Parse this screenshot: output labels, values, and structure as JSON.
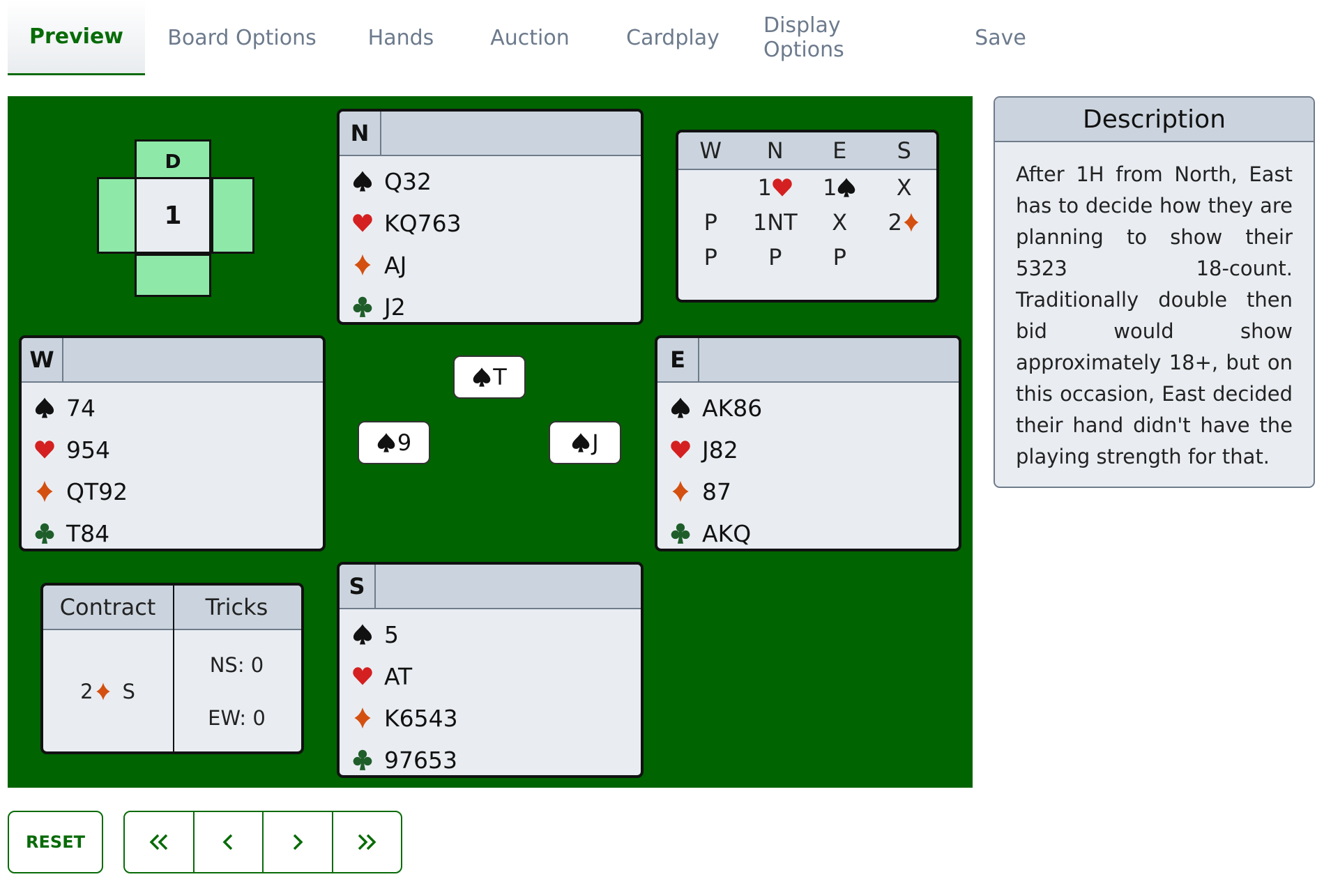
{
  "tabs": [
    {
      "label": "Preview",
      "active": true
    },
    {
      "label": "Board Options"
    },
    {
      "label": "Hands"
    },
    {
      "label": "Auction"
    },
    {
      "label": "Cardplay"
    },
    {
      "label": "Display Options"
    },
    {
      "label": "Save"
    }
  ],
  "colors": {
    "table_green": "#006400",
    "accent_green": "#086b08",
    "panel_bg": "#e9edf2",
    "panel_header": "#cbd4de",
    "compass_green": "#8ee9a8",
    "heart": "#d42020",
    "diamond": "#d45010",
    "club": "#1f5e2a",
    "spade": "#111111"
  },
  "compass": {
    "dealer": "D",
    "board_number": "1"
  },
  "hands": {
    "north": {
      "seat": "N",
      "spades": "Q32",
      "hearts": "KQ763",
      "diamonds": "AJ",
      "clubs": "J2"
    },
    "west": {
      "seat": "W",
      "spades": "74",
      "hearts": "954",
      "diamonds": "QT92",
      "clubs": "T84"
    },
    "east": {
      "seat": "E",
      "spades": "AK86",
      "hearts": "J82",
      "diamonds": "87",
      "clubs": "AKQ"
    },
    "south": {
      "seat": "S",
      "spades": "5",
      "hearts": "AT",
      "diamonds": "K6543",
      "clubs": "97653"
    }
  },
  "auction": {
    "headers": [
      "W",
      "N",
      "E",
      "S"
    ],
    "rows": [
      [
        {
          "text": ""
        },
        {
          "text": "1",
          "suit": "hearts"
        },
        {
          "text": "1",
          "suit": "spades"
        },
        {
          "text": "X"
        }
      ],
      [
        {
          "text": "P"
        },
        {
          "text": "1NT"
        },
        {
          "text": "X"
        },
        {
          "text": "2",
          "suit": "diamonds"
        }
      ],
      [
        {
          "text": "P"
        },
        {
          "text": "P"
        },
        {
          "text": "P"
        },
        {
          "text": ""
        }
      ]
    ]
  },
  "played_cards": {
    "north": {
      "suit": "spades",
      "rank": "T"
    },
    "west": {
      "suit": "spades",
      "rank": "9"
    },
    "east": {
      "suit": "spades",
      "rank": "J"
    }
  },
  "contract": {
    "contract_label": "Contract",
    "tricks_label": "Tricks",
    "level": "2",
    "suit": "diamonds",
    "declarer": "S",
    "ns_tricks": "NS: 0",
    "ew_tricks": "EW: 0"
  },
  "description": {
    "title": "Description",
    "text": "After 1H from North, East has to decide how they are planning to show their 5323 18-count. Traditionally double then bid would show approximately 18+, but on this occasion, East decided their hand didn't have the playing strength for that."
  },
  "controls": {
    "reset_label": "RESET",
    "first_icon": "double-chevron-left-icon",
    "prev_icon": "chevron-left-icon",
    "next_icon": "chevron-right-icon",
    "last_icon": "double-chevron-right-icon"
  }
}
